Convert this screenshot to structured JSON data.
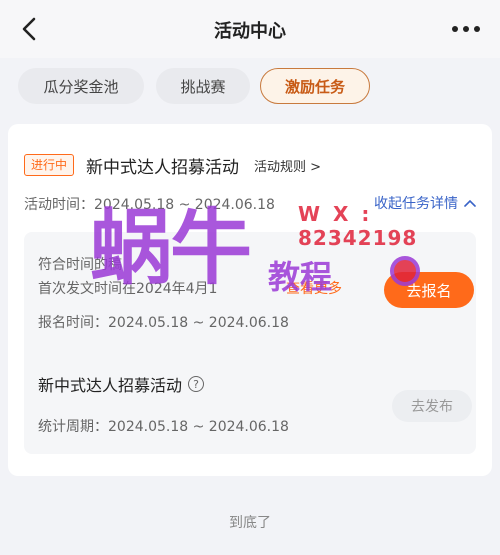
{
  "header": {
    "title": "活动中心"
  },
  "tabs": [
    {
      "label": "瓜分奖金池",
      "active": false
    },
    {
      "label": "挑战赛",
      "active": false
    },
    {
      "label": "激励任务",
      "active": true
    }
  ],
  "activity": {
    "status_badge": "进行中",
    "title": "新中式达人招募活动",
    "rules_link": "活动规则 >",
    "time_text": "活动时间：2024.05.18 ~ 2024.06.18",
    "collapse_label": "收起任务详情",
    "task": {
      "requirement_line1": "符合时间的稿",
      "requirement_line2": "首次发文时间在2024年4月1",
      "view_more": "查看更多",
      "signup_label": "去报名",
      "signup_time": "报名时间：2024.05.18 ~ 2024.06.18",
      "sub_title": "新中式达人招募活动",
      "stat_period": "统计周期：2024.05.18 ~ 2024.06.18",
      "publish_label": "去发布"
    }
  },
  "footer": {
    "end_text": "到底了"
  },
  "watermark": {
    "big_text": "蜗牛",
    "wx_label": "W X :",
    "wx_number": "82342198",
    "sub_text": "教程"
  },
  "colors": {
    "accent_orange": "#ff6a1a",
    "link_blue": "#3a64c8",
    "tab_active_text": "#c85b16"
  }
}
